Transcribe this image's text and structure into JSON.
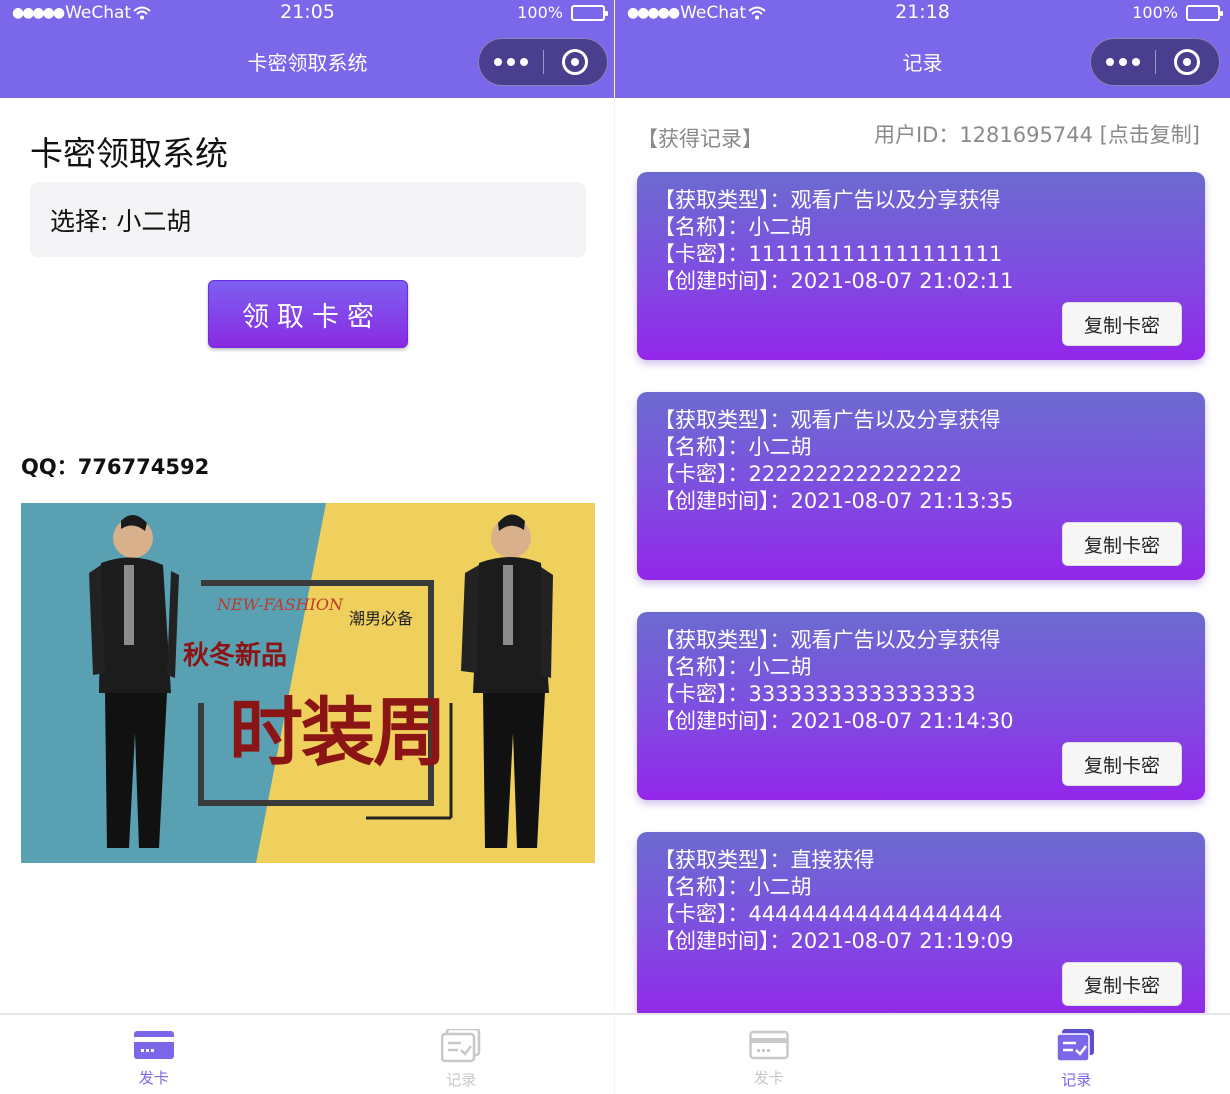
{
  "left": {
    "status": {
      "carrier": "WeChat",
      "time": "21:05",
      "battery": "100%"
    },
    "nav_title": "卡密领取系统",
    "page_title": "卡密领取系统",
    "select_text": "选择: 小二胡",
    "claim_button": "领取卡密",
    "qq_text": "QQ：776774592",
    "banner": {
      "en": "NEW-FASHION",
      "tag": "潮男必备",
      "sub": "秋冬新品",
      "main": "时装周"
    },
    "tabs": [
      {
        "label": "发卡",
        "active": true
      },
      {
        "label": "记录",
        "active": false
      }
    ]
  },
  "right": {
    "status": {
      "carrier": "WeChat",
      "time": "21:18",
      "battery": "100%"
    },
    "nav_title": "记录",
    "records_heading": "【获得记录】",
    "user_id": "用户ID：1281695744 [点击复制]",
    "records": [
      {
        "type": "【获取类型】：观看广告以及分享获得",
        "name": "【名称】：小二胡",
        "key": "【卡密】：1111111111111111111",
        "created": "【创建时间】：2021-08-07 21:02:11",
        "copy": "复制卡密"
      },
      {
        "type": "【获取类型】：观看广告以及分享获得",
        "name": "【名称】：小二胡",
        "key": "【卡密】：2222222222222222",
        "created": "【创建时间】：2021-08-07 21:13:35",
        "copy": "复制卡密"
      },
      {
        "type": "【获取类型】：观看广告以及分享获得",
        "name": "【名称】：小二胡",
        "key": "【卡密】：33333333333333333",
        "created": "【创建时间】：2021-08-07 21:14:30",
        "copy": "复制卡密"
      },
      {
        "type": "【获取类型】：直接获得",
        "name": "【名称】：小二胡",
        "key": "【卡密】：4444444444444444444",
        "created": "【创建时间】：2021-08-07 21:19:09",
        "copy": "复制卡密"
      }
    ],
    "tabs": [
      {
        "label": "发卡",
        "active": false
      },
      {
        "label": "记录",
        "active": true
      }
    ]
  },
  "colors": {
    "accent": "#7b67ea",
    "button_gradient_end": "#8a2be2",
    "muted": "#8a8a8a"
  },
  "icons": {
    "tab1": "card-icon",
    "tab2": "records-icon",
    "more": "more-dots-icon",
    "close": "close-circle-icon"
  }
}
